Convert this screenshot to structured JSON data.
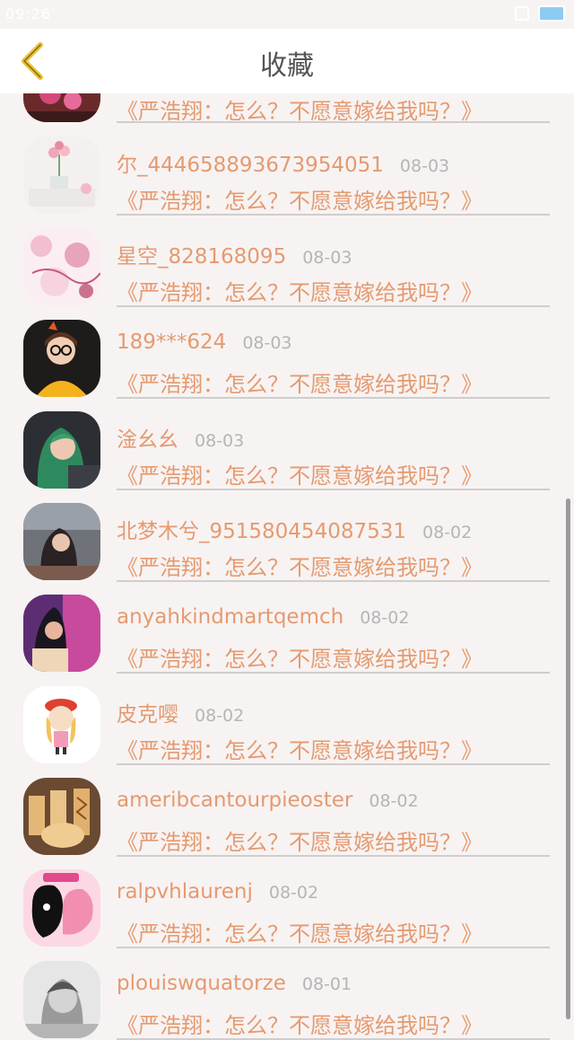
{
  "status_bar": {
    "time": "09:26",
    "battery": "4"
  },
  "header": {
    "title": "收藏",
    "back_icon": "chevron-left-icon"
  },
  "colors": {
    "accent": "#e59a6f",
    "muted": "#b5b5b5",
    "back_icon": "#e8c33a",
    "background": "#f7f3f3"
  },
  "items": [
    {
      "username": "尔_444658893673954051",
      "date": "08-03",
      "title": "《严浩翔：怎么？不愿意嫁给我吗？》"
    },
    {
      "username": "星空_828168095",
      "date": "08-03",
      "title": "《严浩翔：怎么？不愿意嫁给我吗？》"
    },
    {
      "username": "189***624",
      "date": "08-03",
      "title": "《严浩翔：怎么？不愿意嫁给我吗？》"
    },
    {
      "username": "淦幺幺",
      "date": "08-03",
      "title": "《严浩翔：怎么？不愿意嫁给我吗？》"
    },
    {
      "username": "北梦木兮_951580454087531",
      "date": "08-02",
      "title": "《严浩翔：怎么？不愿意嫁给我吗？》"
    },
    {
      "username": "anyahkindmartqemch",
      "date": "08-02",
      "title": "《严浩翔：怎么？不愿意嫁给我吗？》"
    },
    {
      "username": "皮克嘤",
      "date": "08-02",
      "title": "《严浩翔：怎么？不愿意嫁给我吗？》"
    },
    {
      "username": "ameribcantourpieoster",
      "date": "08-02",
      "title": "《严浩翔：怎么？不愿意嫁给我吗？》"
    },
    {
      "username": "ralpvhlaurenj",
      "date": "08-02",
      "title": "《严浩翔：怎么？不愿意嫁给我吗？》"
    },
    {
      "username": "plouiswquatorze",
      "date": "08-01",
      "title": "《严浩翔：怎么？不愿意嫁给我吗？》"
    }
  ],
  "partial_top_item": {
    "title": "《严浩翔：怎么？不愿意嫁给我吗？》"
  }
}
